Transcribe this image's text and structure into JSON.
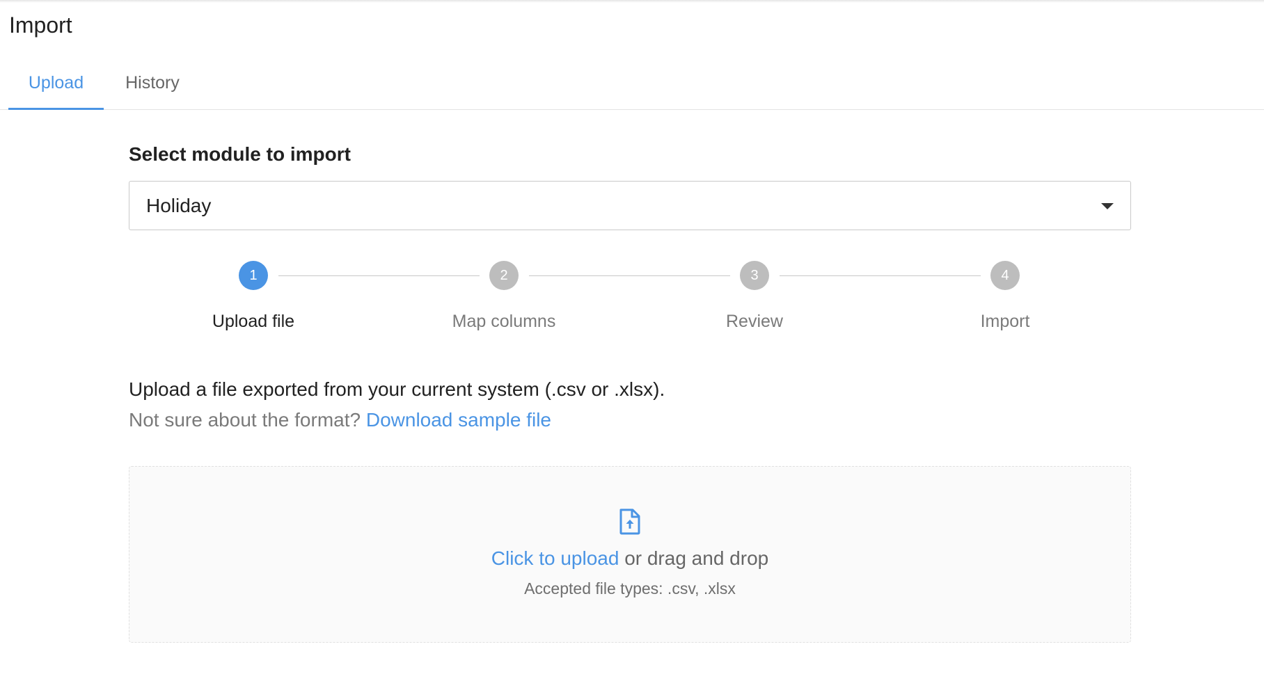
{
  "page": {
    "title": "Import"
  },
  "tabs": [
    {
      "label": "Upload",
      "active": true
    },
    {
      "label": "History",
      "active": false
    }
  ],
  "module_select": {
    "label": "Select module to import",
    "value": "Holiday"
  },
  "steps": [
    {
      "number": "1",
      "label": "Upload file",
      "active": true
    },
    {
      "number": "2",
      "label": "Map columns",
      "active": false
    },
    {
      "number": "3",
      "label": "Review",
      "active": false
    },
    {
      "number": "4",
      "label": "Import",
      "active": false
    }
  ],
  "instructions": {
    "text": "Upload a file exported from your current system (.csv or .xlsx).",
    "format_question": "Not sure about the format?",
    "download_link": "Download sample file"
  },
  "dropzone": {
    "icon": "file-upload-icon",
    "click_link": "Click to upload",
    "drag_text": "or drag and drop",
    "accepted": "Accepted file types: .csv, .xlsx"
  },
  "colors": {
    "accent": "#4a94e4",
    "inactive_step": "#bdbdbd"
  }
}
